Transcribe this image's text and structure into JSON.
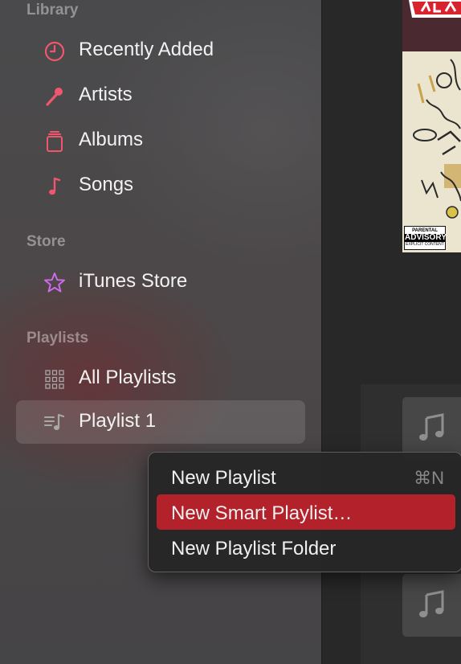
{
  "sidebar": {
    "library": {
      "header": "Library",
      "items": [
        {
          "label": "Recently Added",
          "icon": "clock-icon"
        },
        {
          "label": "Artists",
          "icon": "microphone-icon"
        },
        {
          "label": "Albums",
          "icon": "album-stack-icon"
        },
        {
          "label": "Songs",
          "icon": "music-note-icon"
        }
      ]
    },
    "store": {
      "header": "Store",
      "items": [
        {
          "label": "iTunes Store",
          "icon": "star-icon"
        }
      ]
    },
    "playlists": {
      "header": "Playlists",
      "items": [
        {
          "label": "All Playlists",
          "icon": "grid-icon"
        },
        {
          "label": "Playlist 1",
          "icon": "playlist-icon",
          "selected": true
        }
      ]
    }
  },
  "album": {
    "advisory_line1": "PARENTAL",
    "advisory_line2": "ADVISORY",
    "advisory_line3": "EXPLICIT CONTENT"
  },
  "context_menu": {
    "items": [
      {
        "label": "New Playlist",
        "shortcut": "⌘N",
        "highlighted": false
      },
      {
        "label": "New Smart Playlist…",
        "shortcut": "",
        "highlighted": true
      },
      {
        "label": "New Playlist Folder",
        "shortcut": "",
        "highlighted": false
      }
    ]
  },
  "colors": {
    "accent_pink": "#f0566e",
    "star_purple": "#d36bf0",
    "menu_highlight": "#b3222a"
  }
}
